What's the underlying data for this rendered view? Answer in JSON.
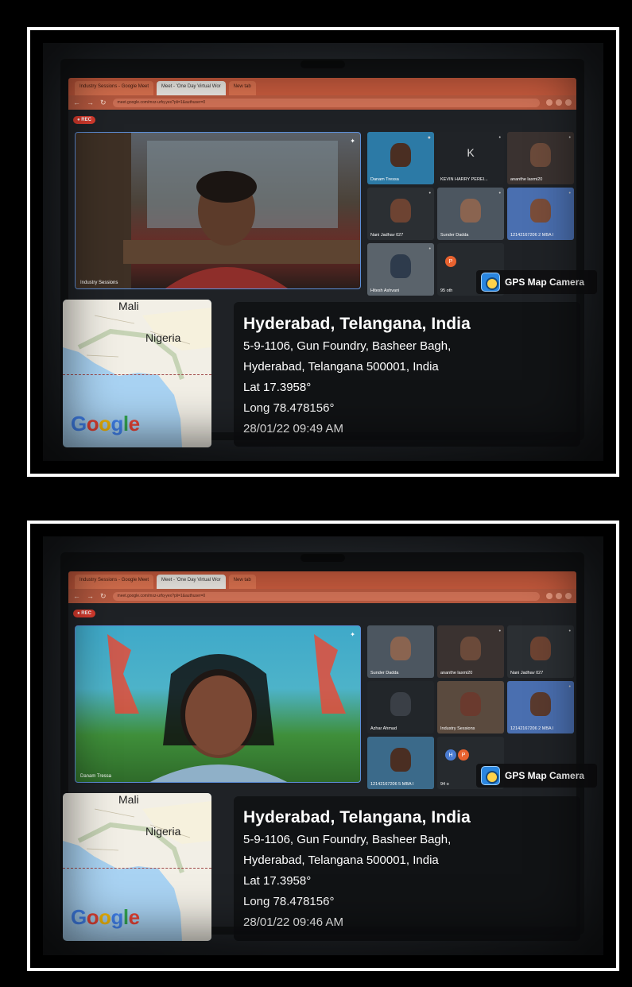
{
  "photos": [
    {
      "browser": {
        "tabs": [
          "Industry Sessions - Google Meet",
          "Meet - 'One Day Virtual Wor",
          "New tab"
        ],
        "url": "meet.google.com/mxz-urfq-yex?pli=1&authuser=0"
      },
      "meet": {
        "rec_label": "REC",
        "main_speaker_name": "Industry Sessions",
        "tiles": [
          {
            "name": "Danam Tressa"
          },
          {
            "name": "KEVIN HARRY PEREI...",
            "letter": "K"
          },
          {
            "name": "ananthe laxmi20"
          },
          {
            "name": "Nani Jadhav 027"
          },
          {
            "name": "Sunder Dadda"
          },
          {
            "name": "12142167206 2 MBA I"
          },
          {
            "name": "Hitesh Ashvani"
          },
          {
            "name": "95 oth",
            "chips": [
              "P"
            ]
          }
        ]
      },
      "gps": {
        "brand": "GPS Map Camera",
        "title": "Hyderabad, Telangana, India",
        "address_line1": "5-9-1106, Gun Foundry, Basheer Bagh,",
        "address_line2": "Hyderabad, Telangana 500001, India",
        "lat": "Lat 17.3958°",
        "long": "Long 78.478156°",
        "datetime": "28/01/22 09:49 AM"
      },
      "map": {
        "label_top": "Mali",
        "label_mid": "Nigeria",
        "logo": "Google"
      }
    },
    {
      "browser": {
        "tabs": [
          "Industry Sessions - Google Meet",
          "Meet - 'One Day Virtual Wor",
          "New tab"
        ],
        "url": "meet.google.com/mxz-urfq-yex?pli=1&authuser=0"
      },
      "meet": {
        "rec_label": "REC",
        "main_speaker_name": "Danam Tressa",
        "tiles": [
          {
            "name": "Sunder Dadda"
          },
          {
            "name": "ananthe laxmi20"
          },
          {
            "name": "Nani Jadhav 027"
          },
          {
            "name": "Azhar Ahmad"
          },
          {
            "name": "Industry Sessions"
          },
          {
            "name": "12142167206 2 MBA I"
          },
          {
            "name": "12142167206 5 MBA I"
          },
          {
            "name": "94 o",
            "chips": [
              "H",
              "P"
            ]
          }
        ]
      },
      "gps": {
        "brand": "GPS Map Camera",
        "title": "Hyderabad, Telangana, India",
        "address_line1": "5-9-1106, Gun Foundry, Basheer Bagh,",
        "address_line2": "Hyderabad, Telangana 500001, India",
        "lat": "Lat 17.3958°",
        "long": "Long 78.478156°",
        "datetime": "28/01/22 09:46 AM"
      },
      "map": {
        "label_top": "Mali",
        "label_mid": "Nigeria",
        "logo": "Google"
      }
    }
  ],
  "colors": {
    "google_blue": "#4285F4",
    "google_red": "#EA4335",
    "google_yellow": "#FBBC05",
    "google_green": "#34A853",
    "rec_red": "#d83b2e",
    "browser_chrome": "#c65a3d"
  }
}
